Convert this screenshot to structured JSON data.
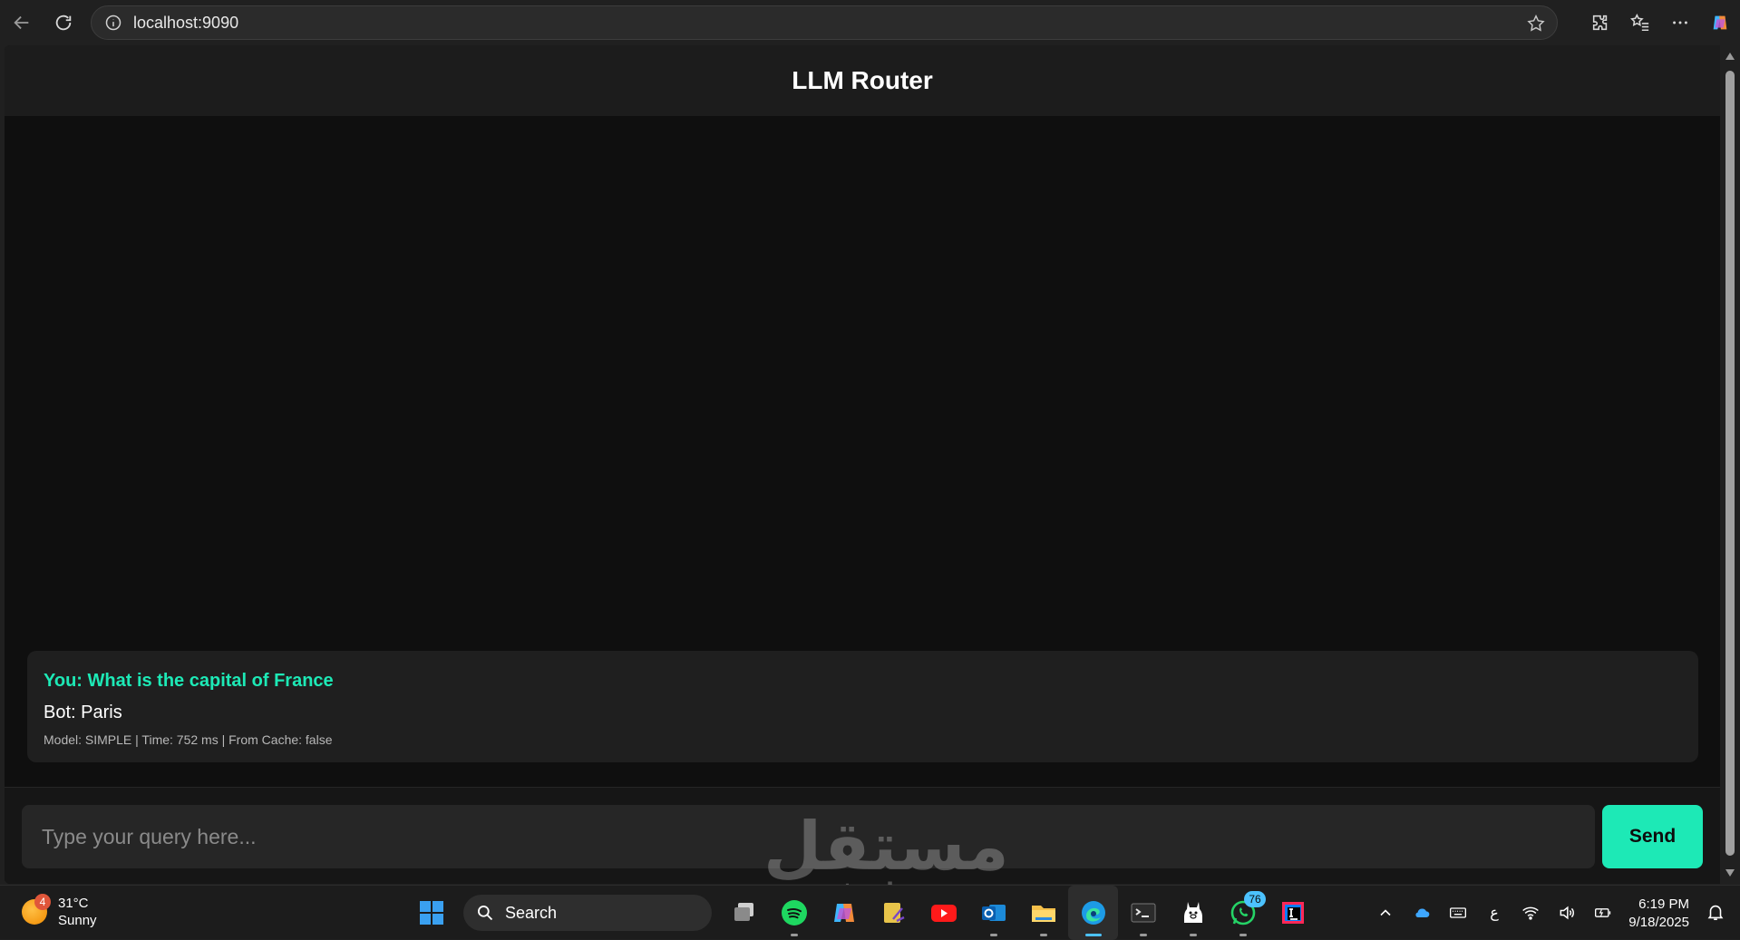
{
  "browser": {
    "url": "localhost:9090"
  },
  "app": {
    "title": "LLM Router"
  },
  "chat": {
    "messages": [
      {
        "user": "You: What is the capital of France",
        "bot": "Bot: Paris",
        "meta": "Model: SIMPLE | Time: 752 ms | From Cache: false"
      }
    ]
  },
  "composer": {
    "placeholder": "Type your query here...",
    "send_label": "Send"
  },
  "watermark": {
    "arabic": "مستقل",
    "latin": "mostaql.com"
  },
  "taskbar": {
    "weather": {
      "badge": "4",
      "temp": "31°C",
      "condition": "Sunny"
    },
    "search_label": "Search",
    "whatsapp_badge": "76",
    "keyboard_lang": "ع",
    "time": "6:19 PM",
    "date": "9/18/2025"
  },
  "colors": {
    "accent": "#1de9b6",
    "background": "#0f0f0f",
    "header": "#1c1c1c",
    "card": "#1f1f1f"
  }
}
